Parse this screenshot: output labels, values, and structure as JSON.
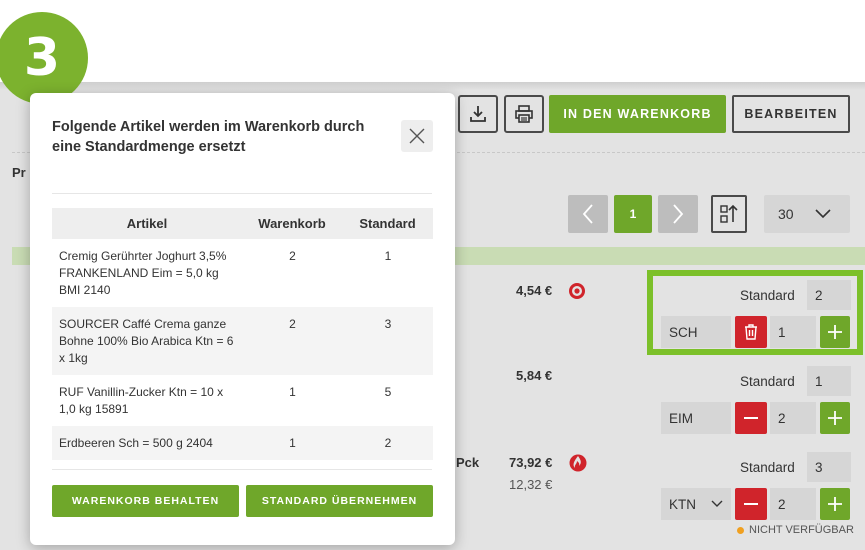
{
  "step": "3",
  "toolbar": {
    "add_to_cart_label": "IN DEN WARENKORB",
    "edit_label": "BEARBEITEN"
  },
  "page": {
    "pr_label": "Pr"
  },
  "pager": {
    "current_page": "1",
    "per_page": "30"
  },
  "products": [
    {
      "price": "4,54 €",
      "std_label": "Standard",
      "std_value": "2",
      "unit": "SCH",
      "qty": "1"
    },
    {
      "price": "5,84 €",
      "std_label": "Standard",
      "std_value": "1",
      "unit": "EIM",
      "qty": "2"
    },
    {
      "price": "73,92 €",
      "price_sub": "12,32 €",
      "pck": "Pck",
      "std_label": "Standard",
      "std_value": "3",
      "unit": "KTN",
      "qty": "2",
      "availability": "NICHT VERFÜGBAR"
    }
  ],
  "modal": {
    "title": "Folgende Artikel werden im Warenkorb durch eine Standardmenge ersetzt",
    "columns": [
      "Artikel",
      "Warenkorb",
      "Standard"
    ],
    "rows": [
      {
        "article": "Cremig Gerührter Joghurt 3,5% FRANKENLAND Eim = 5,0 kg BMI 2140",
        "cart": "2",
        "standard": "1"
      },
      {
        "article": "SOURCER Caffé Crema ganze Bohne 100% Bio Arabica Ktn = 6 x 1kg",
        "cart": "2",
        "standard": "3"
      },
      {
        "article": "RUF Vanillin-Zucker Ktn = 10 x 1,0 kg 15891",
        "cart": "1",
        "standard": "5"
      },
      {
        "article": "Erdbeeren Sch = 500 g 2404",
        "cart": "1",
        "standard": "2"
      }
    ],
    "keep_cart_label": "WARENKORB BEHALTEN",
    "accept_standard_label": "STANDARD ÜBERNEHMEN"
  },
  "colors": {
    "accent_green": "#6fa72a",
    "highlight_green": "#7cc02a",
    "danger_red": "#d0242b",
    "warning_orange": "#f0a020"
  },
  "icons": [
    "download-icon",
    "print-icon",
    "chevron-left-icon",
    "chevron-right-icon",
    "sort-icon",
    "chevron-down-icon",
    "trash-icon",
    "minus-icon",
    "plus-icon",
    "close-icon",
    "target-icon",
    "fire-icon"
  ]
}
